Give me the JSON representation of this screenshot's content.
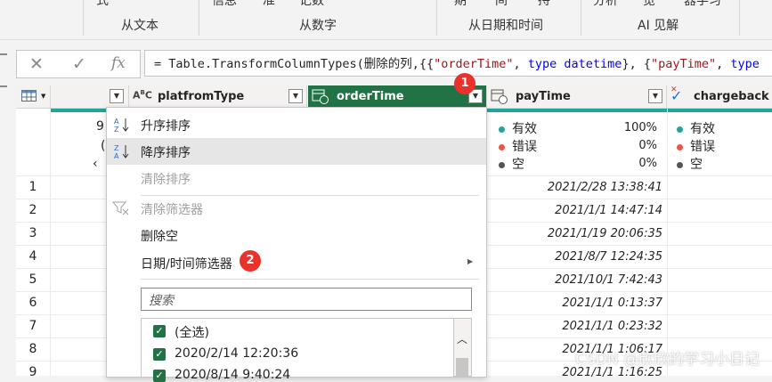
{
  "ribbon": {
    "row1_fragments": [
      "式",
      "信息",
      "准",
      "记数",
      "期",
      "间",
      "持",
      "分析",
      "览",
      "器学习"
    ],
    "groups": [
      "从文本",
      "从数字",
      "从日期和时间",
      "AI 见解"
    ]
  },
  "formula": {
    "cancel_icon": "✕",
    "confirm_icon": "✓",
    "fx_icon": "fx",
    "prefix": "= Table.TransformColumnTypes(删除的列,{{",
    "s1": "\"orderTime\"",
    "sep1": ", ",
    "kw1": "type datetime",
    "sep2": "}, {",
    "s2": "\"payTime\"",
    "sep3": ", ",
    "kw2": "type"
  },
  "columns": {
    "platform": "platfromType",
    "orderTime": "orderTime",
    "payTime": "payTime",
    "chargeback": "chargeback"
  },
  "partial_quality": [
    "9",
    "(",
    "‹"
  ],
  "quality": {
    "valid_label": "有效",
    "error_label": "错误",
    "empty_label": "空",
    "payTime": [
      "100%",
      "0%",
      "0%"
    ],
    "colors": {
      "valid": "#21a49a",
      "error": "#e8564a",
      "empty": "#555555"
    }
  },
  "rows": [
    "1",
    "2",
    "3",
    "4",
    "5",
    "6",
    "7",
    "8",
    "9"
  ],
  "payTime_values": [
    "2021/2/28 13:38:41",
    "2021/1/1 14:47:14",
    "2021/1/19 20:06:35",
    "2021/8/7 12:24:35",
    "2021/10/1 7:42:43",
    "2021/1/1 0:13:37",
    "2021/1/1 0:23:32",
    "2021/1/1 1:06:17",
    "2021/1/1 1:16:25"
  ],
  "menu": {
    "sort_asc": "升序排序",
    "sort_desc": "降序排序",
    "clear_sort": "清除排序",
    "clear_filter": "清除筛选器",
    "remove_empty": "删除空",
    "datetime_filter": "日期/时间筛选器",
    "search_placeholder": "搜索",
    "list": [
      "(全选)",
      "2020/2/14 12:20:36",
      "2020/8/14 9:40:24"
    ]
  },
  "badges": [
    "1",
    "2"
  ],
  "watermark": "CSDN @欣欣的学习小日记"
}
